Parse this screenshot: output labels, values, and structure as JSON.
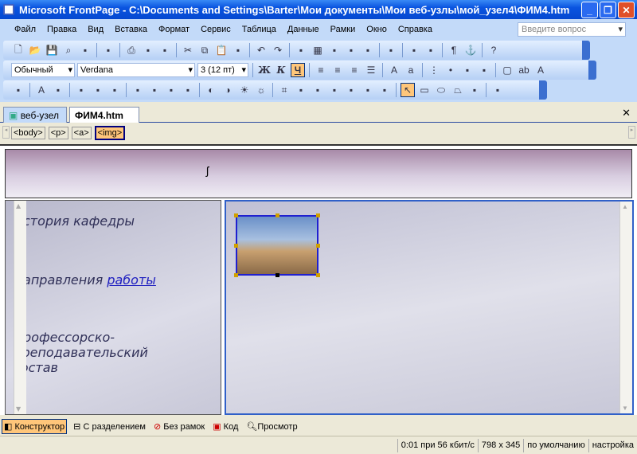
{
  "window": {
    "title": "Microsoft FrontPage - C:\\Documents and Settings\\Barter\\Мои документы\\Мои веб-узлы\\мой_узел4\\ФИМ4.htm"
  },
  "menu": [
    "Файл",
    "Правка",
    "Вид",
    "Вставка",
    "Формат",
    "Сервис",
    "Таблица",
    "Данные",
    "Рамки",
    "Окно",
    "Справка"
  ],
  "ask_placeholder": "Введите вопрос",
  "toolbar_standard": [
    "new-icon",
    "open-icon",
    "save-icon",
    "search-icon",
    "publish-icon",
    "|",
    "folder-list-icon",
    "|",
    "print-icon",
    "preview-icon",
    "spelling-icon",
    "|",
    "cut-icon",
    "copy-icon",
    "paste-icon",
    "format-painter-icon",
    "|",
    "undo-icon",
    "redo-icon",
    "|",
    "web-component-icon",
    "table-icon",
    "layer-icon",
    "picture-icon",
    "drawing-icon",
    "|",
    "hyperlink-icon",
    "|",
    "refresh-icon",
    "stop-icon",
    "|",
    "pilcrow-icon",
    "anchor-icon",
    "|",
    "help-icon"
  ],
  "formatting": {
    "style": "Обычный",
    "font": "Verdana",
    "size": "3  (12 пт)",
    "bold": "Ж",
    "italic": "К",
    "underline": "Ч"
  },
  "toolbar_format": [
    "align-left-icon",
    "align-center-icon",
    "align-right-icon",
    "justify-icon",
    "|",
    "grow-font-icon",
    "shrink-font-icon",
    "|",
    "numbered-list-icon",
    "bullet-list-icon",
    "outdent-icon",
    "indent-icon",
    "|",
    "border-icon",
    "highlight-icon",
    "font-color-icon"
  ],
  "toolbar_picture": [
    "insert-picture-icon",
    "|",
    "text-icon",
    "auto-thumbnail-icon",
    "|",
    "position-absolute-icon",
    "bring-forward-icon",
    "send-backward-icon",
    "|",
    "rotate-left-icon",
    "rotate-right-icon",
    "flip-horizontal-icon",
    "flip-vertical-icon",
    "|",
    "more-contrast-icon",
    "less-contrast-icon",
    "more-brightness-icon",
    "less-brightness-icon",
    "|",
    "crop-icon",
    "line-style-icon",
    "format-picture-icon",
    "set-transparent-color-icon",
    "color-icon",
    "bevel-icon",
    "resample-icon",
    "|",
    "select-icon",
    "rectangle-icon",
    "ellipse-icon",
    "polygon-icon",
    "highlight-hotspots-icon",
    "|",
    "restore-icon"
  ],
  "tabs": [
    {
      "label": "веб-узел"
    },
    {
      "label": "ФИМ4.htm"
    }
  ],
  "tags": [
    "<body>",
    "<p>",
    "<a>",
    "<img>"
  ],
  "page": {
    "cursor": "ʃ",
    "links": [
      "История кафедры",
      "Направления ",
      "работы",
      "Профессорско-\nпреподавательский\nсостав"
    ]
  },
  "views": [
    "Конструктор",
    "С разделением",
    "Без рамок",
    "Код",
    "Просмотр"
  ],
  "status": [
    "0:01 при 56 кбит/с",
    "798 x 345",
    "по умолчанию",
    "настройка"
  ]
}
